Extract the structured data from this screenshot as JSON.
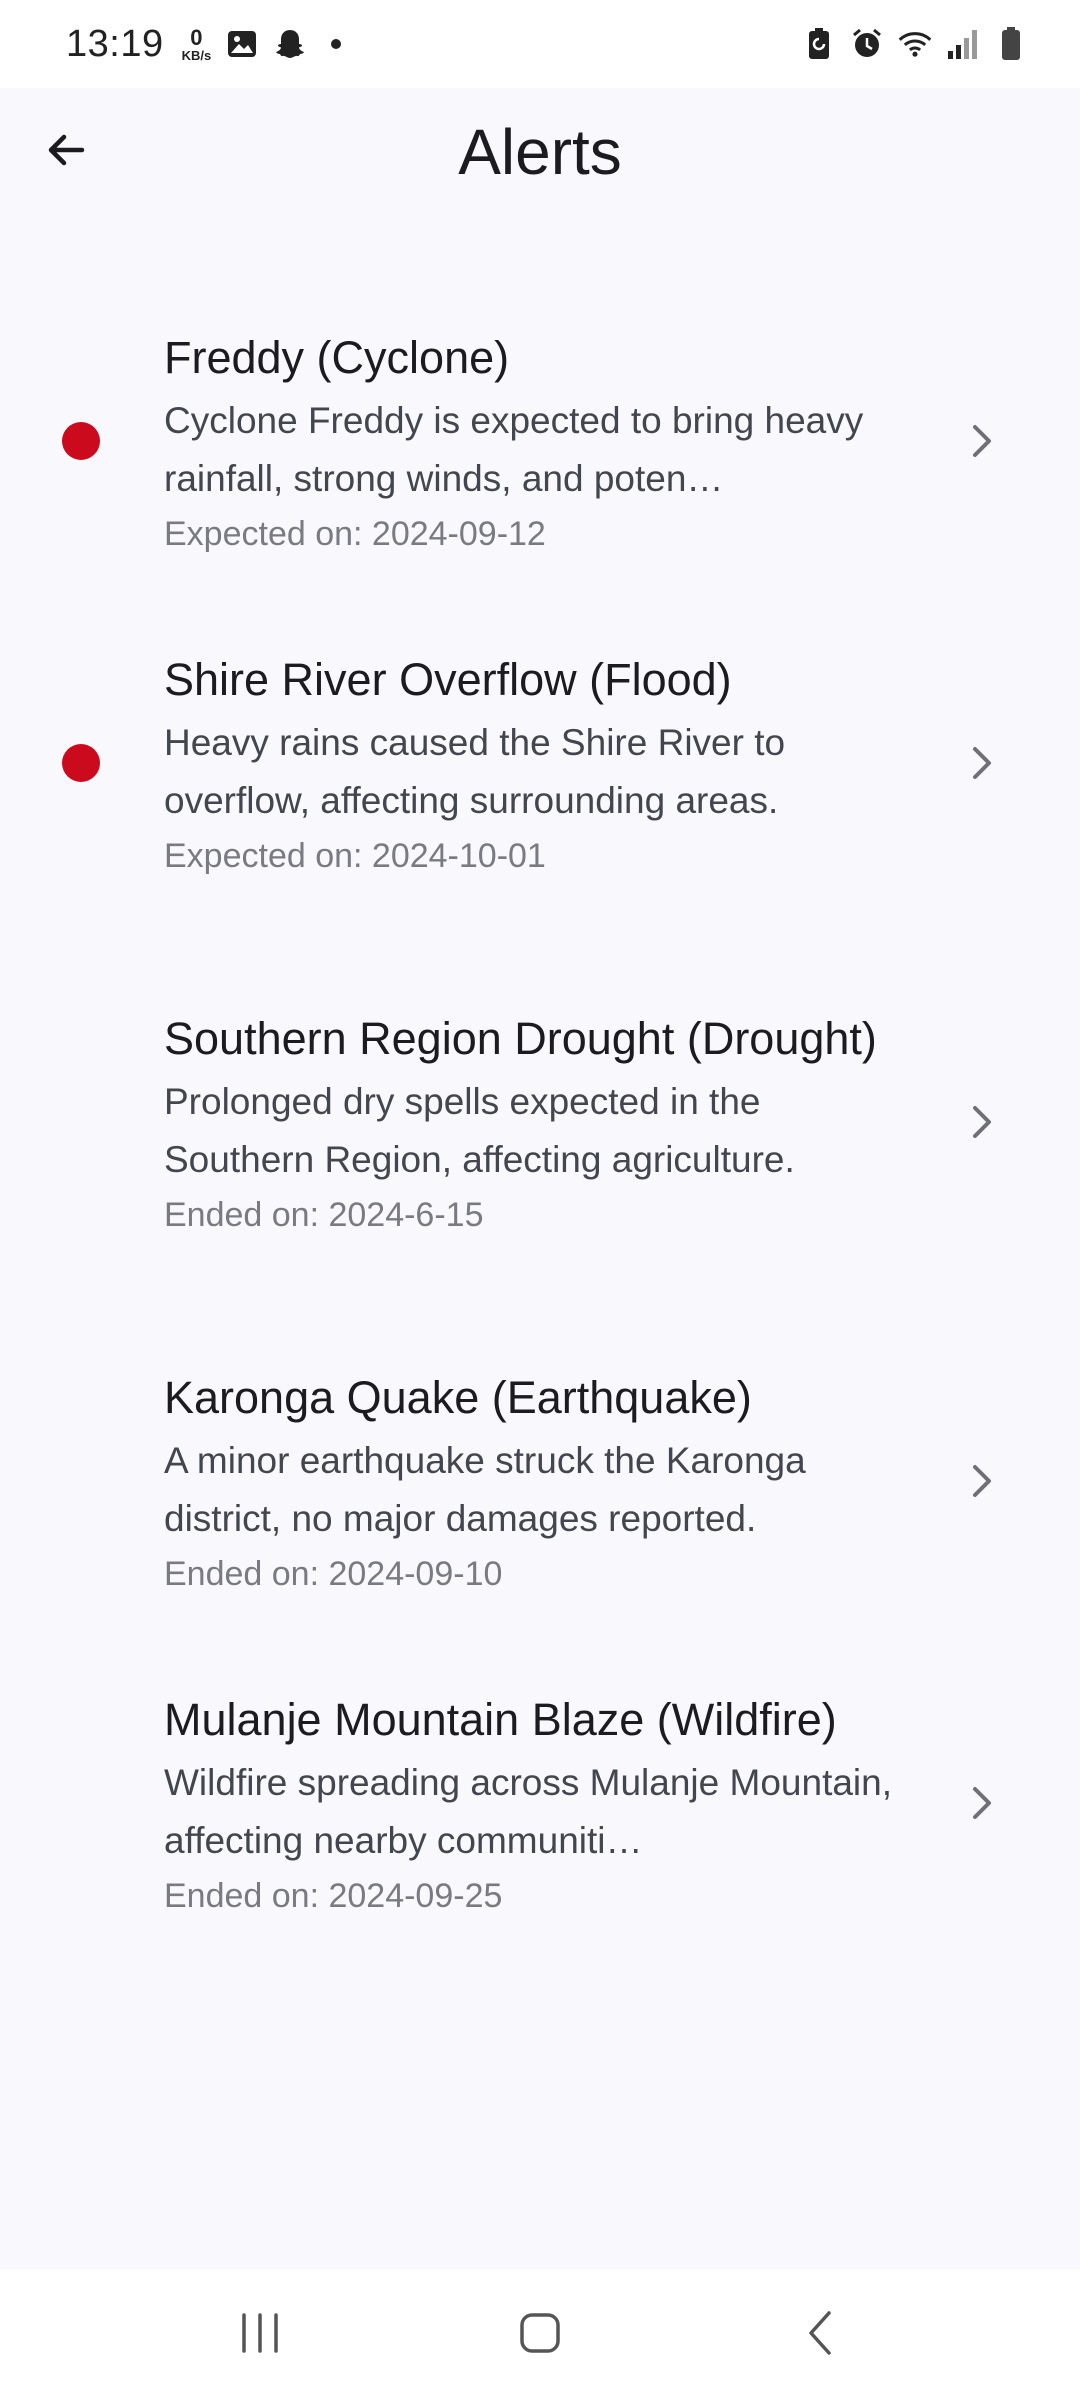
{
  "status_bar": {
    "time": "13:19",
    "net_speed_value": "0",
    "net_speed_unit": "KB/s"
  },
  "header": {
    "title": "Alerts",
    "back_icon": "arrow-left-icon"
  },
  "colors": {
    "active_dot": "#cc0a1e",
    "background": "#f8f8fd"
  },
  "alerts": [
    {
      "title": "Freddy (Cyclone)",
      "description": "Cyclone Freddy is expected to bring heavy rainfall, strong winds, and poten…",
      "date": "Expected on: 2024-09-12",
      "active": true
    },
    {
      "title": "Shire River Overflow (Flood)",
      "description": "Heavy rains caused the Shire River to overflow, affecting surrounding areas.",
      "date": "Expected on: 2024-10-01",
      "active": true
    },
    {
      "title": "Southern Region Drought (Drought)",
      "description": "Prolonged dry spells expected in the Southern Region, affecting agriculture.",
      "date": "Ended on: 2024-6-15",
      "active": false
    },
    {
      "title": "Karonga Quake (Earthquake)",
      "description": "A minor earthquake struck the Karonga district, no major damages reported.",
      "date": "Ended on: 2024-09-10",
      "active": false
    },
    {
      "title": "Mulanje Mountain Blaze (Wildfire)",
      "description": "Wildfire spreading across Mulanje Mountain, affecting nearby communiti…",
      "date": "Ended on: 2024-09-25",
      "active": false
    }
  ]
}
